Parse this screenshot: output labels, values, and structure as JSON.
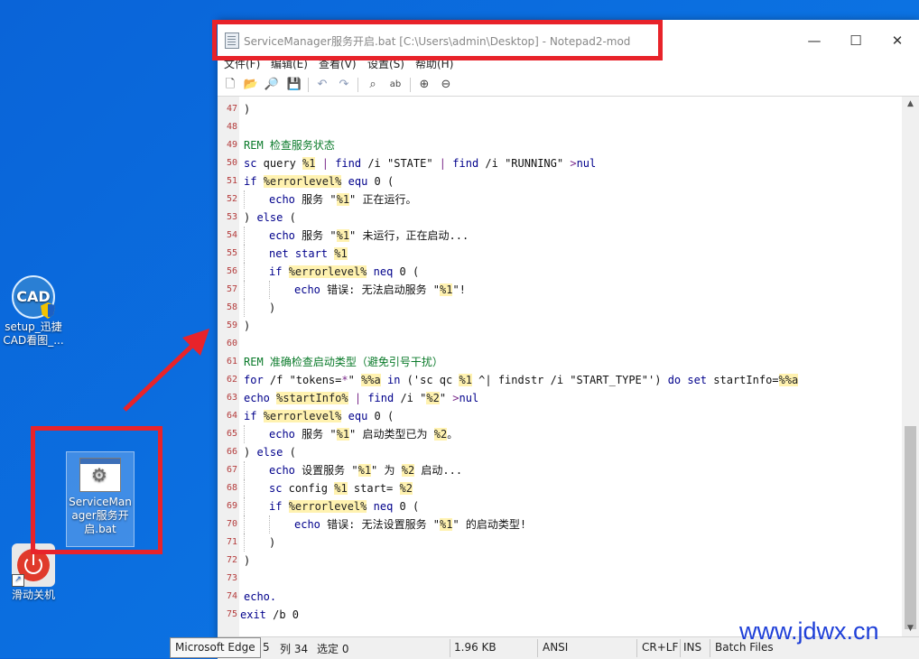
{
  "desktop": {
    "icons": [
      {
        "name": "cad",
        "label_lines": [
          "setup_迅捷",
          "CAD看图_..."
        ],
        "img_text": "CAD"
      },
      {
        "name": "bat",
        "label_lines": [
          "ServiceMan",
          "ager服务开",
          "启.bat"
        ]
      },
      {
        "name": "power",
        "label_lines": [
          "滑动关机"
        ]
      }
    ]
  },
  "window": {
    "title": "ServiceManager服务开启.bat [C:\\Users\\admin\\Desktop] - Notepad2-mod",
    "controls": {
      "minimize": "—",
      "maximize": "☐",
      "close": "✕"
    },
    "menu": [
      "文件(F)",
      "编辑(E)",
      "查看(V)",
      "设置(S)",
      "帮助(H)"
    ]
  },
  "editor": {
    "lines": [
      {
        "n": "47",
        "indent": 1,
        "parts": [
          [
            "p",
            ")"
          ]
        ]
      },
      {
        "n": "48",
        "indent": 0,
        "parts": []
      },
      {
        "n": "49",
        "indent": 1,
        "parts": [
          [
            "c",
            "REM 检查服务状态"
          ]
        ]
      },
      {
        "n": "50",
        "indent": 1,
        "parts": [
          [
            "k",
            "sc"
          ],
          [
            "p",
            " query "
          ],
          [
            "v",
            "%1"
          ],
          [
            "p",
            " "
          ],
          [
            "o",
            "|"
          ],
          [
            "p",
            " "
          ],
          [
            "k",
            "find"
          ],
          [
            "p",
            " /i \"STATE\" "
          ],
          [
            "o",
            "|"
          ],
          [
            "p",
            " "
          ],
          [
            "k",
            "find"
          ],
          [
            "p",
            " /i \"RUNNING\" "
          ],
          [
            "o",
            ">"
          ],
          [
            "k",
            "nul"
          ]
        ]
      },
      {
        "n": "51",
        "indent": 1,
        "parts": [
          [
            "k",
            "if"
          ],
          [
            "p",
            " "
          ],
          [
            "v",
            "%errorlevel%"
          ],
          [
            "p",
            " "
          ],
          [
            "k",
            "equ"
          ],
          [
            "p",
            " 0 ("
          ]
        ]
      },
      {
        "n": "52",
        "indent": 2,
        "parts": [
          [
            "k",
            "echo"
          ],
          [
            "p",
            " 服务 \""
          ],
          [
            "v",
            "%1"
          ],
          [
            "p",
            "\" 正在运行。"
          ]
        ]
      },
      {
        "n": "53",
        "indent": 1,
        "parts": [
          [
            "p",
            ") "
          ],
          [
            "k",
            "else"
          ],
          [
            "p",
            " ("
          ]
        ]
      },
      {
        "n": "54",
        "indent": 2,
        "parts": [
          [
            "k",
            "echo"
          ],
          [
            "p",
            " 服务 \""
          ],
          [
            "v",
            "%1"
          ],
          [
            "p",
            "\" 未运行，正在启动..."
          ]
        ]
      },
      {
        "n": "55",
        "indent": 2,
        "parts": [
          [
            "k",
            "net start"
          ],
          [
            "p",
            " "
          ],
          [
            "v",
            "%1"
          ]
        ]
      },
      {
        "n": "56",
        "indent": 2,
        "parts": [
          [
            "k",
            "if"
          ],
          [
            "p",
            " "
          ],
          [
            "v",
            "%errorlevel%"
          ],
          [
            "p",
            " "
          ],
          [
            "k",
            "neq"
          ],
          [
            "p",
            " 0 ("
          ]
        ]
      },
      {
        "n": "57",
        "indent": 3,
        "parts": [
          [
            "k",
            "echo"
          ],
          [
            "p",
            " 错误: 无法启动服务 \""
          ],
          [
            "v",
            "%1"
          ],
          [
            "p",
            "\"!"
          ]
        ]
      },
      {
        "n": "58",
        "indent": 2,
        "parts": [
          [
            "p",
            ")"
          ]
        ]
      },
      {
        "n": "59",
        "indent": 1,
        "parts": [
          [
            "p",
            ")"
          ]
        ]
      },
      {
        "n": "60",
        "indent": 0,
        "parts": []
      },
      {
        "n": "61",
        "indent": 1,
        "parts": [
          [
            "c",
            "REM 准确检查启动类型（避免引号干扰）"
          ]
        ]
      },
      {
        "n": "62",
        "indent": 1,
        "parts": [
          [
            "k",
            "for"
          ],
          [
            "p",
            " /f \"tokens="
          ],
          [
            "o",
            "*"
          ],
          [
            "p",
            "\" "
          ],
          [
            "v",
            "%%a"
          ],
          [
            "p",
            " "
          ],
          [
            "k",
            "in"
          ],
          [
            "p",
            " ('sc qc "
          ],
          [
            "v",
            "%1"
          ],
          [
            "p",
            " ^| findstr /i \"START_TYPE\"') "
          ],
          [
            "k",
            "do set"
          ],
          [
            "p",
            " startInfo="
          ],
          [
            "v",
            "%%a"
          ]
        ]
      },
      {
        "n": "63",
        "indent": 1,
        "parts": [
          [
            "k",
            "echo"
          ],
          [
            "p",
            " "
          ],
          [
            "v",
            "%startInfo%"
          ],
          [
            "p",
            " "
          ],
          [
            "o",
            "|"
          ],
          [
            "p",
            " "
          ],
          [
            "k",
            "find"
          ],
          [
            "p",
            " /i \""
          ],
          [
            "v",
            "%2"
          ],
          [
            "p",
            "\" "
          ],
          [
            "o",
            ">"
          ],
          [
            "k",
            "nul"
          ]
        ]
      },
      {
        "n": "64",
        "indent": 1,
        "parts": [
          [
            "k",
            "if"
          ],
          [
            "p",
            " "
          ],
          [
            "v",
            "%errorlevel%"
          ],
          [
            "p",
            " "
          ],
          [
            "k",
            "equ"
          ],
          [
            "p",
            " 0 ("
          ]
        ]
      },
      {
        "n": "65",
        "indent": 2,
        "parts": [
          [
            "k",
            "echo"
          ],
          [
            "p",
            " 服务 \""
          ],
          [
            "v",
            "%1"
          ],
          [
            "p",
            "\" 启动类型已为 "
          ],
          [
            "v",
            "%2"
          ],
          [
            "p",
            "。"
          ]
        ]
      },
      {
        "n": "66",
        "indent": 1,
        "parts": [
          [
            "p",
            ") "
          ],
          [
            "k",
            "else"
          ],
          [
            "p",
            " ("
          ]
        ]
      },
      {
        "n": "67",
        "indent": 2,
        "parts": [
          [
            "k",
            "echo"
          ],
          [
            "p",
            " 设置服务 \""
          ],
          [
            "v",
            "%1"
          ],
          [
            "p",
            "\" 为 "
          ],
          [
            "v",
            "%2"
          ],
          [
            "p",
            " 启动..."
          ]
        ]
      },
      {
        "n": "68",
        "indent": 2,
        "parts": [
          [
            "k",
            "sc"
          ],
          [
            "p",
            " config "
          ],
          [
            "v",
            "%1"
          ],
          [
            "p",
            " start= "
          ],
          [
            "v",
            "%2"
          ]
        ]
      },
      {
        "n": "69",
        "indent": 2,
        "parts": [
          [
            "k",
            "if"
          ],
          [
            "p",
            " "
          ],
          [
            "v",
            "%errorlevel%"
          ],
          [
            "p",
            " "
          ],
          [
            "k",
            "neq"
          ],
          [
            "p",
            " 0 ("
          ]
        ]
      },
      {
        "n": "70",
        "indent": 3,
        "parts": [
          [
            "k",
            "echo"
          ],
          [
            "p",
            " 错误: 无法设置服务 \""
          ],
          [
            "v",
            "%1"
          ],
          [
            "p",
            "\" 的启动类型!"
          ]
        ]
      },
      {
        "n": "71",
        "indent": 2,
        "parts": [
          [
            "p",
            ")"
          ]
        ]
      },
      {
        "n": "72",
        "indent": 1,
        "parts": [
          [
            "p",
            ")"
          ]
        ]
      },
      {
        "n": "73",
        "indent": 0,
        "parts": []
      },
      {
        "n": "74",
        "indent": 1,
        "parts": [
          [
            "k",
            "echo."
          ]
        ]
      },
      {
        "n": "75",
        "indent": 0,
        "parts": [
          [
            "k",
            "exit"
          ],
          [
            "p",
            " /b 0"
          ]
        ]
      }
    ]
  },
  "colors": {
    "keyword": "#00008b",
    "comment": "#0a7a2a",
    "variable_bg": "#fff2b0",
    "variable": "#222222",
    "operator": "#7a2a8a"
  },
  "statusbar": {
    "ln_tail": "5",
    "col": "列 34",
    "sel": "选定 0",
    "size": "1.96 KB",
    "encoding": "ANSI",
    "eol": "CR+LF",
    "ins": "INS",
    "lang": "Batch Files"
  },
  "tooltip": "Microsoft Edge",
  "watermark": "www.jdwx.cn"
}
